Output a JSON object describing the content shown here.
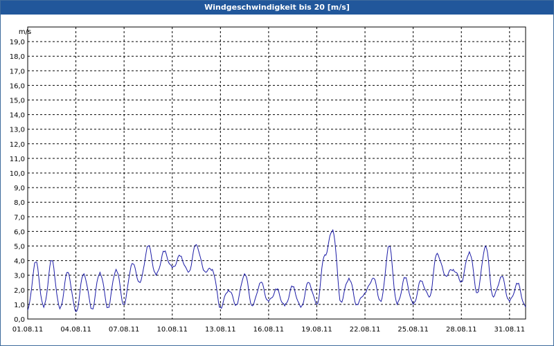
{
  "chart_data": {
    "type": "line",
    "title": "Windgeschwindigkeit bis 20 [m/s]",
    "ylabel": "m/s",
    "xlabel": "",
    "ylim": [
      0,
      20
    ],
    "xlim": [
      "2011-08-01 00:00",
      "2011-09-01 00:00"
    ],
    "grid": true,
    "line_color": "#1a1aa6",
    "y_ticks": [
      "0,0",
      "1,0",
      "2,0",
      "3,0",
      "4,0",
      "5,0",
      "6,0",
      "7,0",
      "8,0",
      "9,0",
      "10,0",
      "11,0",
      "12,0",
      "13,0",
      "14,0",
      "15,0",
      "16,0",
      "17,0",
      "18,0",
      "19,0"
    ],
    "x_ticks": [
      "01.08.11",
      "04.08.11",
      "07.08.11",
      "10.08.11",
      "13.08.11",
      "16.08.11",
      "19.08.11",
      "22.08.11",
      "25.08.11",
      "28.08.11",
      "31.08.11"
    ],
    "series": [
      {
        "name": "",
        "x": [
          "2011-08-01",
          "2011-08-01 12:00",
          "2011-08-02",
          "2011-08-02 12:00",
          "2011-08-03",
          "2011-08-03 12:00",
          "2011-08-04",
          "2011-08-04 12:00",
          "2011-08-05",
          "2011-08-05 12:00",
          "2011-08-06",
          "2011-08-06 12:00",
          "2011-08-07",
          "2011-08-07 12:00",
          "2011-08-08",
          "2011-08-08 12:00",
          "2011-08-09",
          "2011-08-09 12:00",
          "2011-08-10",
          "2011-08-10 12:00",
          "2011-08-11",
          "2011-08-11 12:00",
          "2011-08-12",
          "2011-08-12 12:00",
          "2011-08-13",
          "2011-08-13 12:00",
          "2011-08-14",
          "2011-08-14 12:00",
          "2011-08-15",
          "2011-08-15 12:00",
          "2011-08-16",
          "2011-08-16 12:00",
          "2011-08-17",
          "2011-08-17 12:00",
          "2011-08-18",
          "2011-08-18 12:00",
          "2011-08-19",
          "2011-08-19 12:00",
          "2011-08-20",
          "2011-08-20 12:00",
          "2011-08-21",
          "2011-08-21 12:00",
          "2011-08-22",
          "2011-08-22 12:00",
          "2011-08-23",
          "2011-08-23 12:00",
          "2011-08-24",
          "2011-08-24 12:00",
          "2011-08-25",
          "2011-08-25 12:00",
          "2011-08-26",
          "2011-08-26 12:00",
          "2011-08-27",
          "2011-08-27 12:00",
          "2011-08-28",
          "2011-08-28 12:00",
          "2011-08-29",
          "2011-08-29 12:00",
          "2011-08-30",
          "2011-08-30 12:00",
          "2011-08-31",
          "2011-08-31 12:00",
          "2011-09-01"
        ],
        "values": [
          0.6,
          3.9,
          0.8,
          4.0,
          0.7,
          3.2,
          0.5,
          3.1,
          0.7,
          3.2,
          0.8,
          3.4,
          1.0,
          3.8,
          2.5,
          5.0,
          3.0,
          4.6,
          3.5,
          4.3,
          3.2,
          5.1,
          3.3,
          3.4,
          0.8,
          2.0,
          1.0,
          3.1,
          0.9,
          2.5,
          1.2,
          2.0,
          0.9,
          2.2,
          0.8,
          2.5,
          1.0,
          4.4,
          6.1,
          1.2,
          2.8,
          1.0,
          1.8,
          2.8,
          1.2,
          5.0,
          1.0,
          2.8,
          1.0,
          2.6,
          1.5,
          4.5,
          3.0,
          3.4,
          2.6,
          4.6,
          1.8,
          5.0,
          1.5,
          2.9,
          1.2,
          2.4,
          0.8
        ]
      }
    ]
  }
}
